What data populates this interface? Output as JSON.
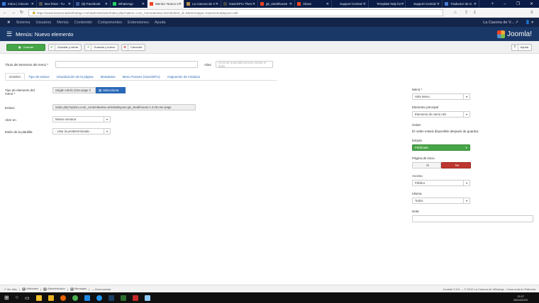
{
  "browser": {
    "tabs": [
      {
        "label": "Inbox | CiscoH",
        "color": "#3b78d8"
      },
      {
        "label": "Box fetos - Tu",
        "color": "#555555"
      },
      {
        "label": "(5) Facebook",
        "color": "#3b5998"
      },
      {
        "label": "WhatsApp",
        "color": "#25d366"
      },
      {
        "label": "Menús: Nuevo e",
        "color": "#f44321",
        "active": true
      },
      {
        "label": "La Casona de V",
        "color": "#b58a4c"
      },
      {
        "label": "GavickPro Then",
        "color": "#444444"
      },
      {
        "label": "gk_steakhouse",
        "color": "#f44321"
      },
      {
        "label": "About",
        "color": "#f44321"
      },
      {
        "label": "Support Central",
        "color": "#0b1d47"
      },
      {
        "label": "Template help for",
        "color": "#0b1d47"
      },
      {
        "label": "Support Central",
        "color": "#0b1d47"
      },
      {
        "label": "Traductor de G",
        "color": "#4a7bd0"
      }
    ],
    "url": "https://www.lacasonadevillodrigo.com/administrator/index.php?option=com_menus&view=item&client_id=0&menutype=mainmenu&layout=edit"
  },
  "nav": {
    "items": [
      "Sistema",
      "Usuarios",
      "Menús",
      "Contenido",
      "Componentes",
      "Extensiones",
      "Ayuda"
    ],
    "site": "La Casona de V... ↗",
    "user": "👤 ▾"
  },
  "header": {
    "title": "Menús: Nuevo elemento",
    "logo": "Joomla!"
  },
  "toolbar": {
    "save": "Guardar",
    "save_close": "Guardar y cerrar",
    "save_new": "Guardar y nuevo",
    "cancel": "Cancelar",
    "help": "Ayuda"
  },
  "form": {
    "title_label": "Título del elemento del menú *",
    "title_value": "",
    "alias_label": "Alias",
    "alias_placeholder": "Generar automáticamente desde el título",
    "tabs": [
      "Detalles",
      "Tipo de enlace",
      "Visualización de la página",
      "Metadatos",
      "Menu Params (GavickPro)",
      "Asignación de módulos"
    ],
    "type_label": "Tipo de elemento del menú *",
    "type_value": "Single Article (One-page li",
    "select_btn": "Seleccionar",
    "link_label": "Enlace",
    "link_value": "index.php?option=com_content&view=article&layout=gk_steakhouse:1.3.26:one-page",
    "open_label": "Abrir en",
    "open_value": "Misma ventana",
    "style_label": "Estilo de la plantilla",
    "style_value": "- Usar la predeterminada -"
  },
  "side": {
    "menu_label": "Menú *",
    "menu_value": "Hide Menu",
    "parent_label": "Elemento principal",
    "parent_value": "Elemento de menú raíz",
    "order_label": "Orden",
    "order_text": "El orden estará disponible después de guardar.",
    "state_label": "Estado",
    "state_value": "Publicado",
    "home_label": "Página de inicio",
    "home_yes": "Sí",
    "home_no": "No",
    "access_label": "Acceso",
    "access_value": "Público",
    "lang_label": "Idioma",
    "lang_value": "Todos",
    "note_label": "Nota",
    "note_value": ""
  },
  "status": {
    "view_site": "Ver sitio",
    "visitors": "Visitantes",
    "visitors_count": "0",
    "admins": "Administrador",
    "admins_count": "0",
    "messages": "Mensajes",
    "messages_count": "0",
    "logout": "Desconectar",
    "footer": "Joomla! 3.9.5 — © 2019 La Casona de Villodrigo - Casa rural en Palencia"
  },
  "taskbar": {
    "time": "13:37",
    "date": "26/04/2019"
  }
}
